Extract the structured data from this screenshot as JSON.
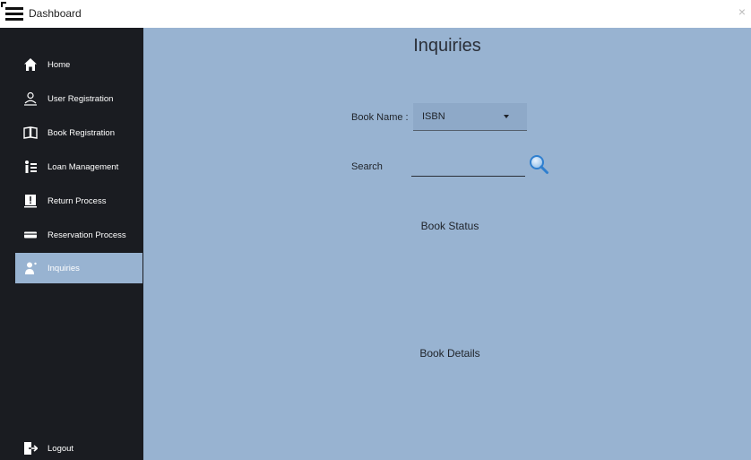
{
  "window": {
    "title": "Dashboard",
    "close_symbol": "×"
  },
  "sidebar": {
    "items": [
      {
        "label": "Home",
        "icon": "home-icon"
      },
      {
        "label": "User Registration",
        "icon": "user-registration-icon"
      },
      {
        "label": "Book Registration",
        "icon": "book-icon"
      },
      {
        "label": "Loan Management",
        "icon": "loan-icon"
      },
      {
        "label": "Return Process",
        "icon": "return-icon"
      },
      {
        "label": "Reservation Process",
        "icon": "reservation-icon"
      },
      {
        "label": "Inquiries",
        "icon": "inquiries-icon",
        "active": true
      }
    ],
    "logout": {
      "label": "Logout",
      "icon": "logout-icon"
    }
  },
  "main": {
    "title": "Inquiries",
    "book_name_label": "Book Name :",
    "book_name_value": "ISBN",
    "search_label": "Search",
    "search_value": "",
    "book_status_label": "Book Status",
    "book_details_label": "Book Details"
  },
  "colors": {
    "sidebar_bg": "#1a1c21",
    "main_bg": "#98b3d1",
    "active_item_bg": "#98b3d1"
  }
}
